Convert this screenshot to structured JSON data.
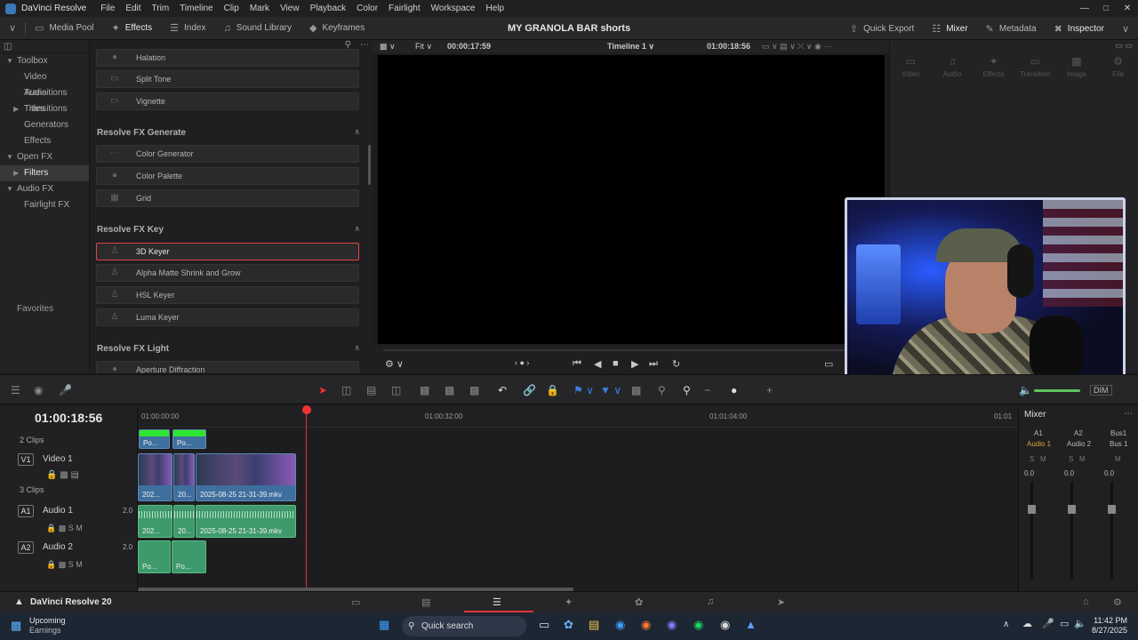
{
  "window": {
    "app_title": "DaVinci Resolve",
    "menu": [
      "File",
      "Edit",
      "Trim",
      "Timeline",
      "Clip",
      "Mark",
      "View",
      "Playback",
      "Color",
      "Fairlight",
      "Workspace",
      "Help"
    ]
  },
  "toolbar": {
    "media_pool": "Media Pool",
    "effects": "Effects",
    "index": "Index",
    "sound_library": "Sound Library",
    "keyframes": "Keyframes",
    "project_title": "MY GRANOLA BAR shorts",
    "quick_export": "Quick Export",
    "mixer": "Mixer",
    "metadata": "Metadata",
    "inspector": "Inspector"
  },
  "sidebar": {
    "toolbox": "Toolbox",
    "video_transitions": "Video Transitions",
    "audio_transitions": "Audio Transitions",
    "titles": "Titles",
    "generators": "Generators",
    "effects": "Effects",
    "open_fx": "Open FX",
    "filters": "Filters",
    "audio_fx": "Audio FX",
    "fairlight_fx": "Fairlight FX",
    "favorites": "Favorites"
  },
  "effects_list": {
    "top_items": [
      "Halation",
      "Split Tone",
      "Vignette"
    ],
    "group_generate": "Resolve FX Generate",
    "generate_items": [
      "Color Generator",
      "Color Palette",
      "Grid"
    ],
    "group_key": "Resolve FX Key",
    "key_items": [
      "3D Keyer",
      "Alpha Matte Shrink and Grow",
      "HSL Keyer",
      "Luma Keyer"
    ],
    "group_light": "Resolve FX Light",
    "light_items": [
      "Aperture Diffraction"
    ]
  },
  "viewer": {
    "fit": "Fit",
    "source_timecode": "00:00:17:59",
    "timeline_name": "Timeline 1",
    "record_timecode": "01:00:18:56"
  },
  "inspector_tabs": [
    "Video",
    "Audio",
    "Effects",
    "Transition",
    "Image",
    "File"
  ],
  "timeline": {
    "timecode": "01:00:18:56",
    "ruler": [
      "01:00:00:00",
      "01:00:32:00",
      "01:01:04:00",
      "01:01"
    ],
    "title_clips_count": "2 Clips",
    "video_clips_count": "3 Clips",
    "v1_badge": "V1",
    "v1_name": "Video 1",
    "a1_badge": "A1",
    "a1_name": "Audio 1",
    "a1_level": "2.0",
    "a2_badge": "A2",
    "a2_name": "Audio 2",
    "a2_level": "2.0",
    "title_clip_caption": "Po...",
    "clip_short_1": "202...",
    "clip_short_2": "20...",
    "clip_main": "2025-08-25 21-31-39.mkv",
    "a2_clip_caption": "Po...",
    "dim": "DIM"
  },
  "mixer": {
    "title": "Mixer",
    "channels": [
      "A1",
      "A2",
      "Bus1"
    ],
    "channel_names": [
      "Audio 1",
      "Audio 2",
      "Bus 1"
    ],
    "levels": [
      "0.0",
      "0.0",
      "0.0"
    ]
  },
  "pagebar": {
    "brand": "DaVinci Resolve 20"
  },
  "taskbar": {
    "weather_title": "Upcoming",
    "weather_sub": "Earnings",
    "search": "Quick search",
    "time": "11:42 PM",
    "date": "8/27/2025"
  },
  "colors": {
    "selection_red": "#dd4444",
    "video_clip": "#3f6f9e",
    "audio_clip": "#3e9a6a",
    "title_bar_green": "#2ee62e",
    "playhead": "#ee3333"
  }
}
